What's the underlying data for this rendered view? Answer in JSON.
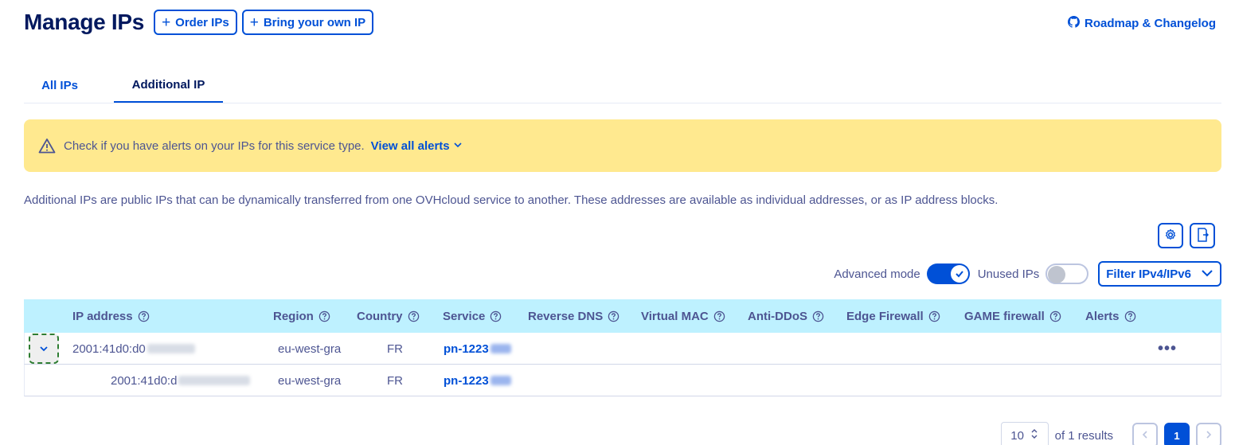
{
  "header": {
    "title": "Manage IPs",
    "order_label": "Order IPs",
    "byoip_label": "Bring your own IP",
    "roadmap_label": "Roadmap & Changelog"
  },
  "tabs": [
    {
      "label": "All IPs",
      "active": false
    },
    {
      "label": "Additional IP",
      "active": true
    }
  ],
  "alert": {
    "message": "Check if you have alerts on your IPs for this service type.",
    "link_label": "View all alerts"
  },
  "description": "Additional IPs are public IPs that can be dynamically transferred from one OVHcloud service to another. These addresses are available as individual addresses, or as IP address blocks.",
  "toolbar": {
    "advanced_mode_label": "Advanced mode",
    "advanced_mode_on": true,
    "unused_ips_label": "Unused IPs",
    "unused_ips_on": false,
    "filter_label": "Filter IPv4/IPv6"
  },
  "table": {
    "columns": [
      "IP address",
      "Region",
      "Country",
      "Service",
      "Reverse DNS",
      "Virtual MAC",
      "Anti-DDoS",
      "Edge Firewall",
      "GAME firewall",
      "Alerts"
    ],
    "rows": [
      {
        "ip": "2001:41d0:d0",
        "region": "eu-west-gra",
        "country": "FR",
        "service": "pn-1223"
      },
      {
        "ip": "2001:41d0:d",
        "region": "eu-west-gra",
        "country": "FR",
        "service": "pn-1223"
      }
    ]
  },
  "pagination": {
    "page_size": "10",
    "results_label": "of 1 results",
    "current_page": "1"
  },
  "colors": {
    "primary": "#0050d7",
    "title": "#00185e",
    "text": "#4d5592",
    "alert_bg": "#ffe98f",
    "table_header_bg": "#bef1ff"
  },
  "icons": [
    "plus-icon",
    "github-icon",
    "warning-icon",
    "chevron-down-icon",
    "gear-icon",
    "export-icon",
    "check-icon",
    "help-icon",
    "more-icon",
    "chevron-left-icon",
    "chevron-right-icon",
    "sort-icon"
  ]
}
